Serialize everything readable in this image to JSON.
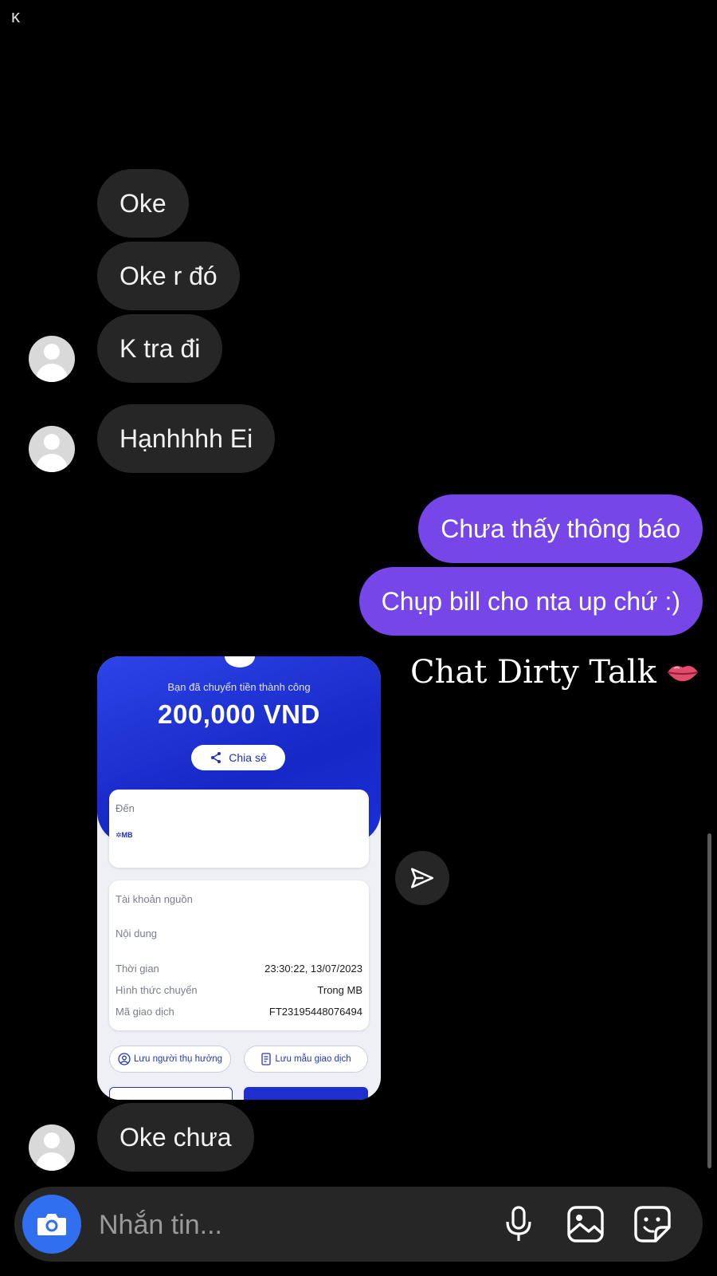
{
  "status_glyph": "ĸ",
  "messages": {
    "m1": "Oke",
    "m2": "Oke r đó",
    "m3": "K tra đi",
    "m4": "Hạnhhhh Ei",
    "m5": "Chưa thấy thông báo",
    "m6": "Chụp bill cho nta up chứ :)",
    "m7": "Oke chưa"
  },
  "receipt": {
    "headline": "Bạn đã chuyển tiền thành công",
    "amount": "200,000 VND",
    "share_label": "Chia sẻ",
    "to_label": "Đến",
    "bank_logo": "MB",
    "source_label": "Tài khoản nguồn",
    "content_label": "Nội dung",
    "rows": [
      {
        "label": "Thời gian",
        "value": "23:30:22, 13/07/2023"
      },
      {
        "label": "Hình thức chuyển",
        "value": "Trong MB"
      },
      {
        "label": "Mã giao dịch",
        "value": "FT23195448076494"
      }
    ],
    "save_beneficiary": "Lưu người thụ hưởng",
    "save_template": "Lưu mẫu giao dịch"
  },
  "overlay_caption": "Chat Dirty Talk",
  "composer": {
    "placeholder": "Nhắn tin..."
  },
  "icons": {
    "camera": "camera-icon",
    "mic": "microphone-icon",
    "gallery": "gallery-icon",
    "sticker": "sticker-icon",
    "forward": "send-forward-icon",
    "caption_emoji": "lips-emoji"
  },
  "colors": {
    "background": "#000000",
    "incoming_bubble": "#262626",
    "outgoing_bubble": "#7646e8",
    "camera_button": "#2f6ff0",
    "receipt_blue": "#1628c6"
  }
}
